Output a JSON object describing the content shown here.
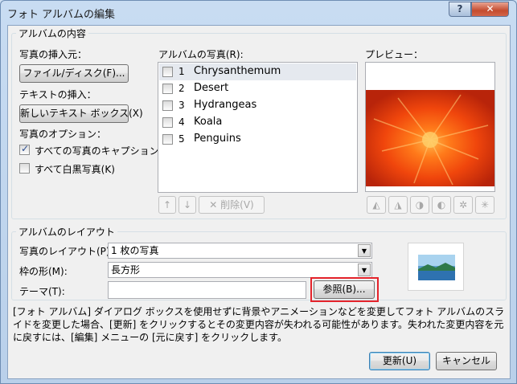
{
  "window": {
    "title": "フォト アルバムの編集",
    "help_label": "?",
    "close_label": "✕"
  },
  "content_group": {
    "title": "アルバムの内容",
    "insert_from_label": "写真の挿入元：",
    "file_disk_button": "ファイル/ディスク(F)...",
    "insert_text_label": "テキストの挿入：",
    "new_textbox_button": "新しいテキスト ボックス(X)",
    "photo_options_label": "写真のオプション：",
    "caption_checkbox": {
      "label": "すべての写真のキャプション(A)",
      "checked": true
    },
    "bw_checkbox": {
      "label": "すべて白黒写真(K)",
      "checked": false
    }
  },
  "photos": {
    "label": "アルバムの写真(R):",
    "items": [
      {
        "num": "1",
        "name": "Chrysanthemum",
        "checked": false,
        "selected": true
      },
      {
        "num": "2",
        "name": "Desert",
        "checked": false,
        "selected": false
      },
      {
        "num": "3",
        "name": "Hydrangeas",
        "checked": false,
        "selected": false
      },
      {
        "num": "4",
        "name": "Koala",
        "checked": false,
        "selected": false
      },
      {
        "num": "5",
        "name": "Penguins",
        "checked": false,
        "selected": false
      }
    ],
    "up_icon": "↑",
    "down_icon": "↓",
    "delete_button": "✕ 削除(V)"
  },
  "preview": {
    "label": "プレビュー：",
    "tool_icons": [
      "rotate-left-icon",
      "rotate-right-icon",
      "contrast-up-icon",
      "contrast-down-icon",
      "brightness-up-icon",
      "brightness-down-icon"
    ]
  },
  "layout_group": {
    "title": "アルバムのレイアウト",
    "picture_layout_label": "写真のレイアウト(P):",
    "picture_layout_value": "1 枚の写真",
    "frame_shape_label": "枠の形(M):",
    "frame_shape_value": "長方形",
    "theme_label": "テーマ(T):",
    "theme_value": "",
    "browse_button": "参照(B)..."
  },
  "info_text": "[フォト アルバム] ダイアログ ボックスを使用せずに背景やアニメーションなどを変更してフォト アルバムのスライドを変更した場合、[更新] をクリックするとその変更内容が失われる可能性があります。失われた変更内容を元に戻すには、[編集] メニューの [元に戻す] をクリックします。",
  "footer": {
    "update_button": "更新(U)",
    "cancel_button": "キャンセル"
  },
  "colors": {
    "highlight_border": "#e4232b",
    "selection": "#e5e9ef"
  }
}
